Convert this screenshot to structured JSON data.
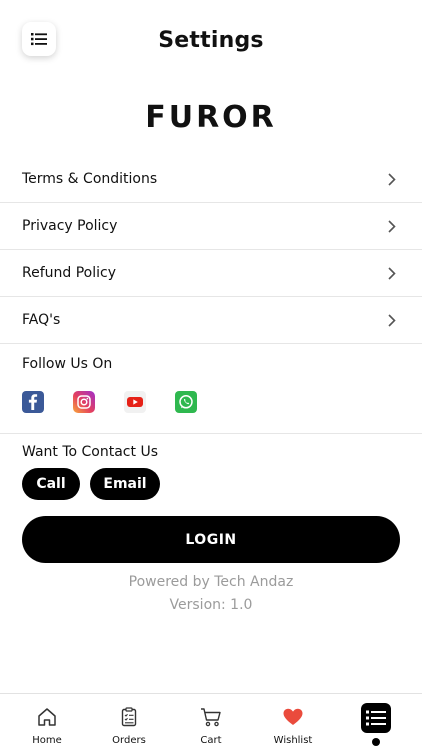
{
  "header": {
    "title": "Settings"
  },
  "logo": {
    "text": "FUROR"
  },
  "menu": [
    {
      "label": "Terms & Conditions"
    },
    {
      "label": "Privacy Policy"
    },
    {
      "label": "Refund Policy"
    },
    {
      "label": "FAQ's"
    }
  ],
  "follow": {
    "title": "Follow Us On",
    "icons": [
      "facebook-icon",
      "instagram-icon",
      "youtube-icon",
      "whatsapp-icon"
    ]
  },
  "contact": {
    "title": "Want To Contact Us",
    "call_label": "Call",
    "email_label": "Email"
  },
  "login_label": "LOGIN",
  "footer": {
    "powered": "Powered by Tech Andaz",
    "version": "Version: 1.0"
  },
  "tabs": [
    {
      "label": "Home",
      "icon": "home-icon"
    },
    {
      "label": "Orders",
      "icon": "clipboard-icon"
    },
    {
      "label": "Cart",
      "icon": "cart-icon"
    },
    {
      "label": "Wishlist",
      "icon": "heart-icon"
    },
    {
      "label": "",
      "icon": "list-icon",
      "active": true
    }
  ],
  "colors": {
    "accent": "#000000",
    "heart": "#ea4b3c",
    "muted": "#9b9b9b"
  }
}
